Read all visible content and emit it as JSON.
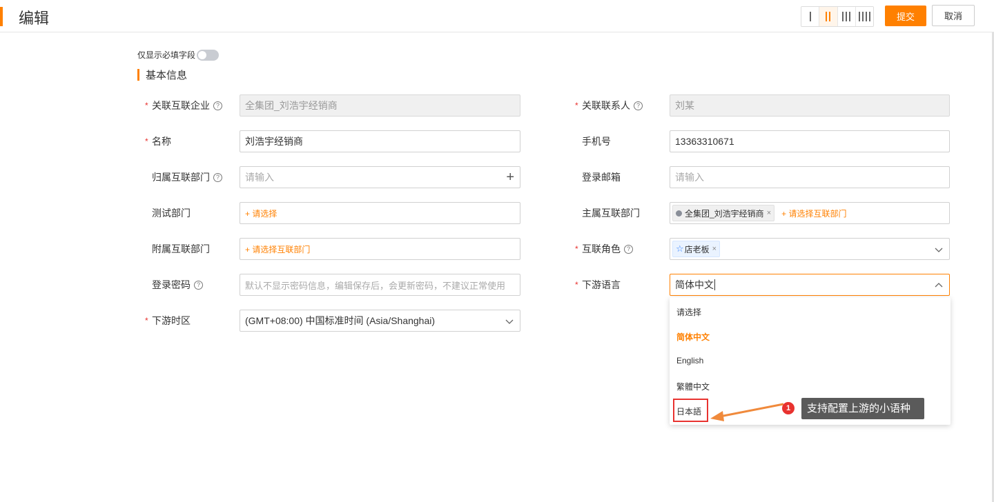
{
  "header": {
    "title": "编辑",
    "submit_label": "提交",
    "cancel_label": "取消",
    "layout_options": [
      "1-column-icon",
      "2-column-icon",
      "3-column-icon",
      "4-column-icon"
    ],
    "active_layout": "2-column-icon",
    "accent_color": "#ff8000"
  },
  "form": {
    "required_only_label": "仅显示必填字段",
    "required_only_on": false,
    "section_title": "基本信息",
    "fields": {
      "partner_company": {
        "label": "关联互联企业",
        "value": "全集团_刘浩宇经销商",
        "required": true
      },
      "contact": {
        "label": "关联联系人",
        "value": "刘某",
        "required": true
      },
      "name": {
        "label": "名称",
        "value": "刘浩宇经销商",
        "required": true
      },
      "phone": {
        "label": "手机号",
        "value": "13363310671"
      },
      "dept": {
        "label": "归属互联部门",
        "placeholder": "请输入"
      },
      "email": {
        "label": "登录邮箱",
        "placeholder": "请输入"
      },
      "test_dept": {
        "label": "测试部门",
        "action": "+ 请选择"
      },
      "main_dept": {
        "label": "主属互联部门",
        "tag": "全集团_刘浩宇经销商",
        "action": "+ 请选择互联部门"
      },
      "sub_dept": {
        "label": "附属互联部门",
        "action": "+ 请选择互联部门"
      },
      "role": {
        "label": "互联角色",
        "tag": "店老板",
        "required": true
      },
      "password": {
        "label": "登录密码",
        "placeholder": "默认不显示密码信息，编辑保存后，会更新密码，不建议正常使用"
      },
      "language": {
        "label": "下游语言",
        "value": "简体中文",
        "required": true
      },
      "timezone": {
        "label": "下游时区",
        "value": "(GMT+08:00) 中国标准时间 (Asia/Shanghai)",
        "required": true
      }
    }
  },
  "language_dropdown": {
    "options": [
      "请选择",
      "简体中文",
      "English",
      "繁體中文",
      "日本語"
    ],
    "selected": "简体中文"
  },
  "annotation": {
    "badge": "1",
    "text": "支持配置上游的小语种"
  }
}
